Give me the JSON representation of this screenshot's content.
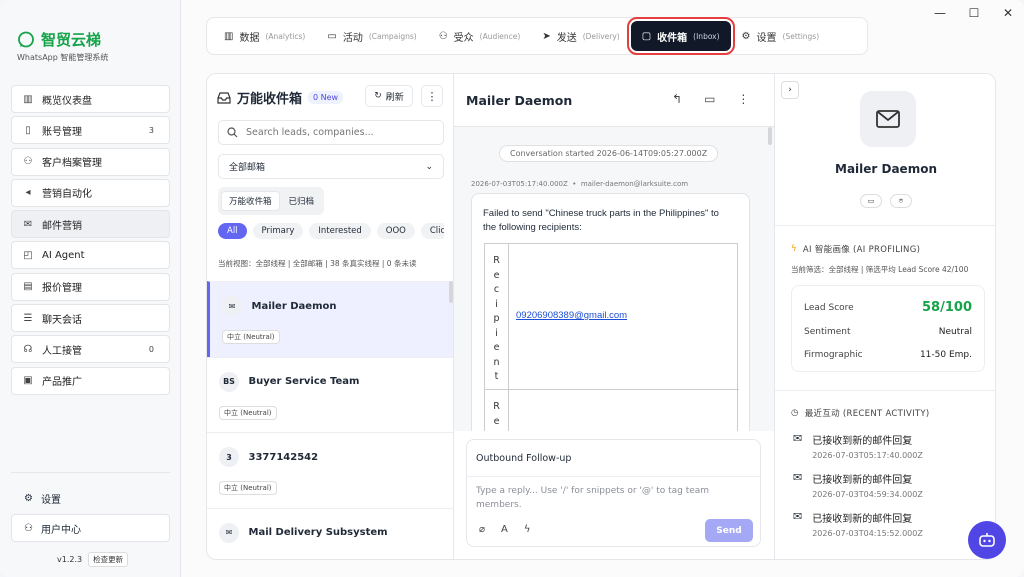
{
  "window": {
    "controls": [
      "—",
      "☐",
      "✕"
    ]
  },
  "brand": {
    "name": "智贸云梯",
    "subtitle": "WhatsApp 智能管理系统",
    "color": "#16a34a"
  },
  "nav": [
    {
      "label": "概览仪表盘",
      "icon": "chart-icon",
      "glyph": "▥"
    },
    {
      "label": "账号管理",
      "icon": "phone-icon",
      "glyph": "▯",
      "count": "3"
    },
    {
      "label": "客户档案管理",
      "icon": "users-icon",
      "glyph": "⚇"
    },
    {
      "label": "营销自动化",
      "icon": "megaphone-icon",
      "glyph": "◂"
    },
    {
      "label": "邮件营销",
      "icon": "mail-icon",
      "glyph": "✉",
      "active": true
    },
    {
      "label": "AI Agent",
      "icon": "bot-icon",
      "glyph": "◰"
    },
    {
      "label": "报价管理",
      "icon": "document-icon",
      "glyph": "▤"
    },
    {
      "label": "聊天会话",
      "icon": "list-icon",
      "glyph": "☰"
    },
    {
      "label": "人工接管",
      "icon": "headset-icon",
      "glyph": "☊",
      "count": "0"
    },
    {
      "label": "产品推广",
      "icon": "book-icon",
      "glyph": "▣"
    }
  ],
  "footer": {
    "settings": "设置",
    "user_center": "用户中心",
    "version": "v1.2.3",
    "update": "检查更新"
  },
  "tabs": [
    {
      "label": "数据",
      "en": "(Analytics)",
      "glyph": "▥"
    },
    {
      "label": "活动",
      "en": "(Campaigns)",
      "glyph": "▭"
    },
    {
      "label": "受众",
      "en": "(Audience)",
      "glyph": "⚇"
    },
    {
      "label": "发送",
      "en": "(Delivery)",
      "glyph": "➤"
    },
    {
      "label": "收件箱",
      "en": "(Inbox)",
      "glyph": "▢",
      "active": true
    },
    {
      "label": "设置",
      "en": "(Settings)",
      "glyph": "⚙"
    }
  ],
  "inbox": {
    "title": "万能收件箱",
    "new_badge": "0 New",
    "refresh": "刷新",
    "search_placeholder": "Search leads, companies...",
    "mailbox_select": "全部邮箱",
    "segments": [
      "万能收件箱",
      "已归档"
    ],
    "chips": [
      "All",
      "Primary",
      "Interested",
      "OOO",
      "Clicke"
    ],
    "view_line": "当前视图：全部线程 | 全部邮箱 | 38 条真实线程 | 0 条未读",
    "items": [
      {
        "name": "Mailer Daemon",
        "avatar": "✉",
        "tag": "中立 (Neutral)",
        "selected": true
      },
      {
        "name": "Buyer Service Team",
        "avatar": "BS",
        "tag": "中立 (Neutral)"
      },
      {
        "name": "3377142542",
        "avatar": "3",
        "tag": "中立 (Neutral)"
      },
      {
        "name": "Mail Delivery Subsystem",
        "avatar": "✉",
        "tag": ""
      }
    ]
  },
  "conversation": {
    "title": "Mailer Daemon",
    "started": "Conversation started 2026-06-14T09:05:27.000Z",
    "meta_time": "2026-07-03T05:17:40.000Z",
    "meta_from": "mailer-daemon@larksuite.com",
    "fail_text": "Failed to send \"Chinese truck parts in the Philippines\" to the following recipients:",
    "recipient_header": "Recipient",
    "recipient_header_2": "Re",
    "recipient_email": "09206908389@gmail.com",
    "compose_subject": "Outbound Follow-up",
    "compose_placeholder": "Type a reply... Use '/' for snippets or '@' to tag team members.",
    "send": "Send"
  },
  "profile": {
    "name": "Mailer Daemon",
    "ai_title": "AI 智能画像 (AI PROFILING)",
    "ai_sub": "当前筛选：全部线程 | 筛选平均 Lead Score 42/100",
    "lead_score_label": "Lead Score",
    "lead_score": "58/100",
    "sentiment_label": "Sentiment",
    "sentiment": "Neutral",
    "firmographic_label": "Firmographic",
    "firmographic": "11-50 Emp.",
    "activity_title": "最近互动 (RECENT ACTIVITY)",
    "activities": [
      {
        "text": "已接收到新的邮件回复",
        "time": "2026-07-03T05:17:40.000Z"
      },
      {
        "text": "已接收到新的邮件回复",
        "time": "2026-07-03T04:59:34.000Z"
      },
      {
        "text": "已接收到新的邮件回复",
        "time": "2026-07-03T04:15:52.000Z"
      }
    ]
  },
  "colors": {
    "accent": "#6366f1",
    "active_tab": "#111827",
    "highlight": "#e53e3e",
    "lead_score": "#16a34a"
  }
}
